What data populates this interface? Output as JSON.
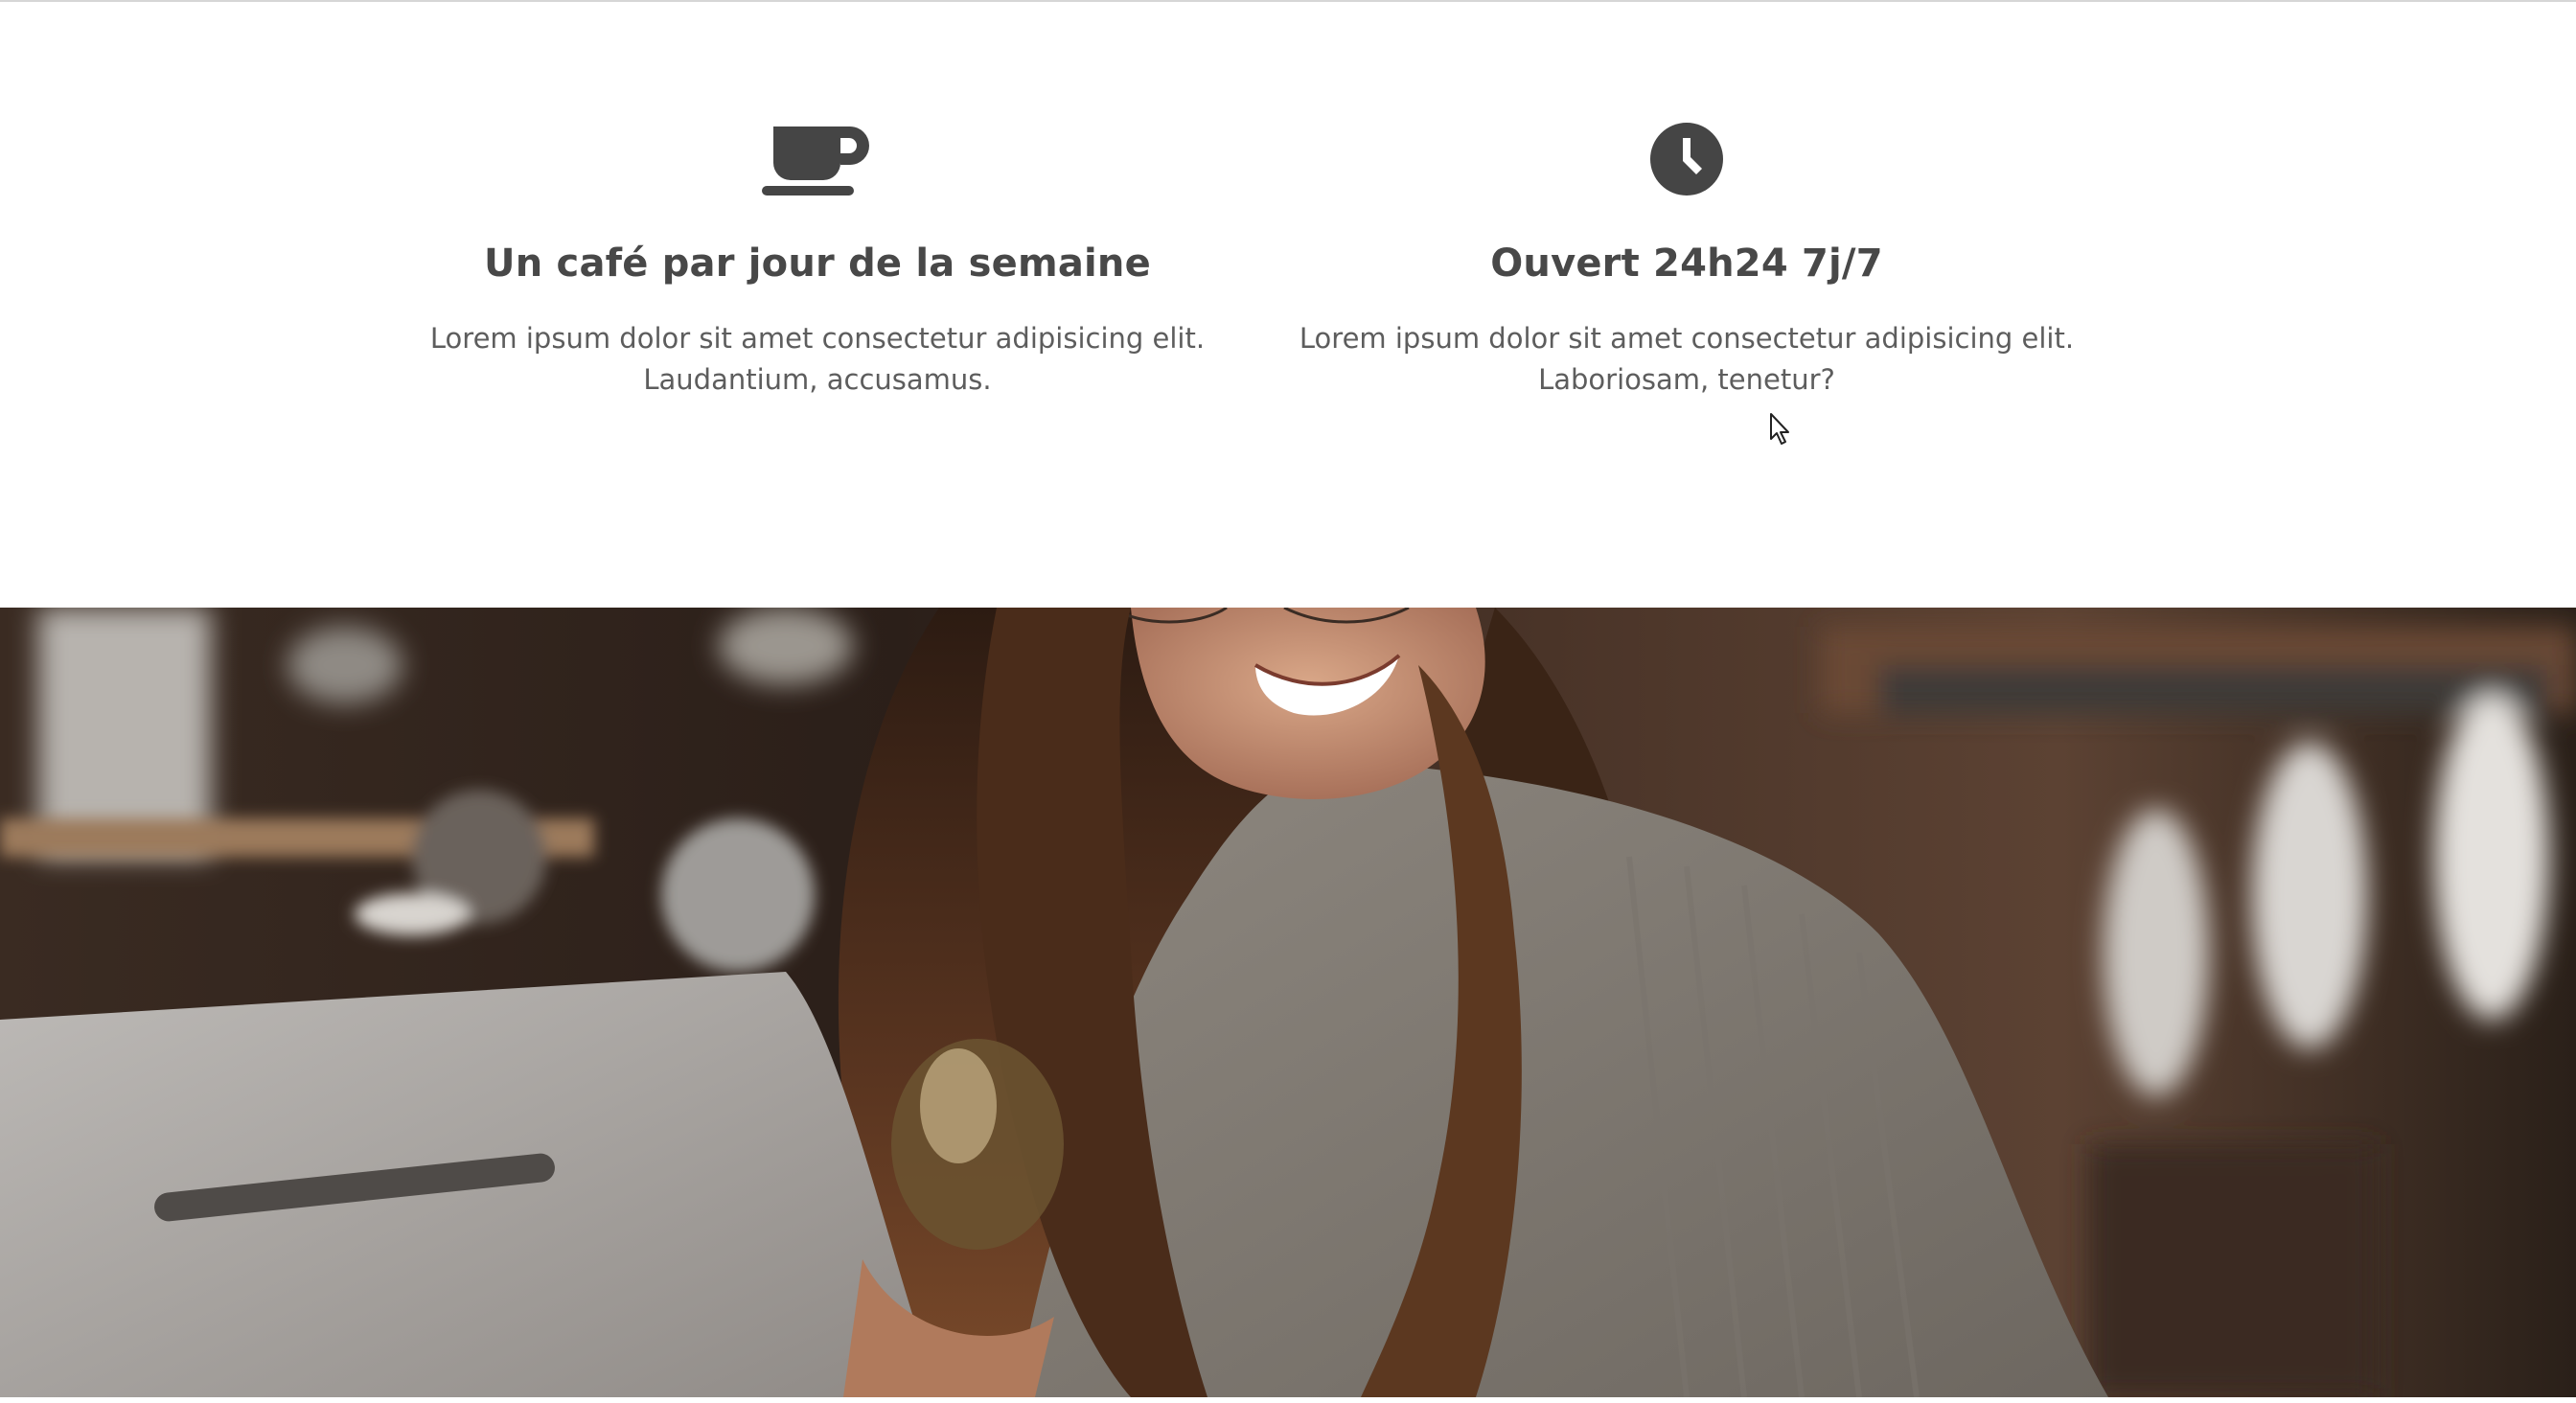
{
  "features": [
    {
      "icon": "coffee-cup-icon",
      "title": "Un café par jour de la semaine",
      "text_line1": "Lorem ipsum dolor sit amet consectetur adipisicing elit.",
      "text_line2": "Laudantium, accusamus."
    },
    {
      "icon": "clock-icon",
      "title": "Ouvert 24h24 7j/7",
      "text_line1": "Lorem ipsum dolor sit amet consectetur adipisicing elit.",
      "text_line2": "Laboriosam, tenetur?"
    }
  ],
  "hero": {
    "image": "barista-woman-smiling-photo"
  },
  "colors": {
    "text": "#4a4a4a",
    "icon": "#454545"
  }
}
